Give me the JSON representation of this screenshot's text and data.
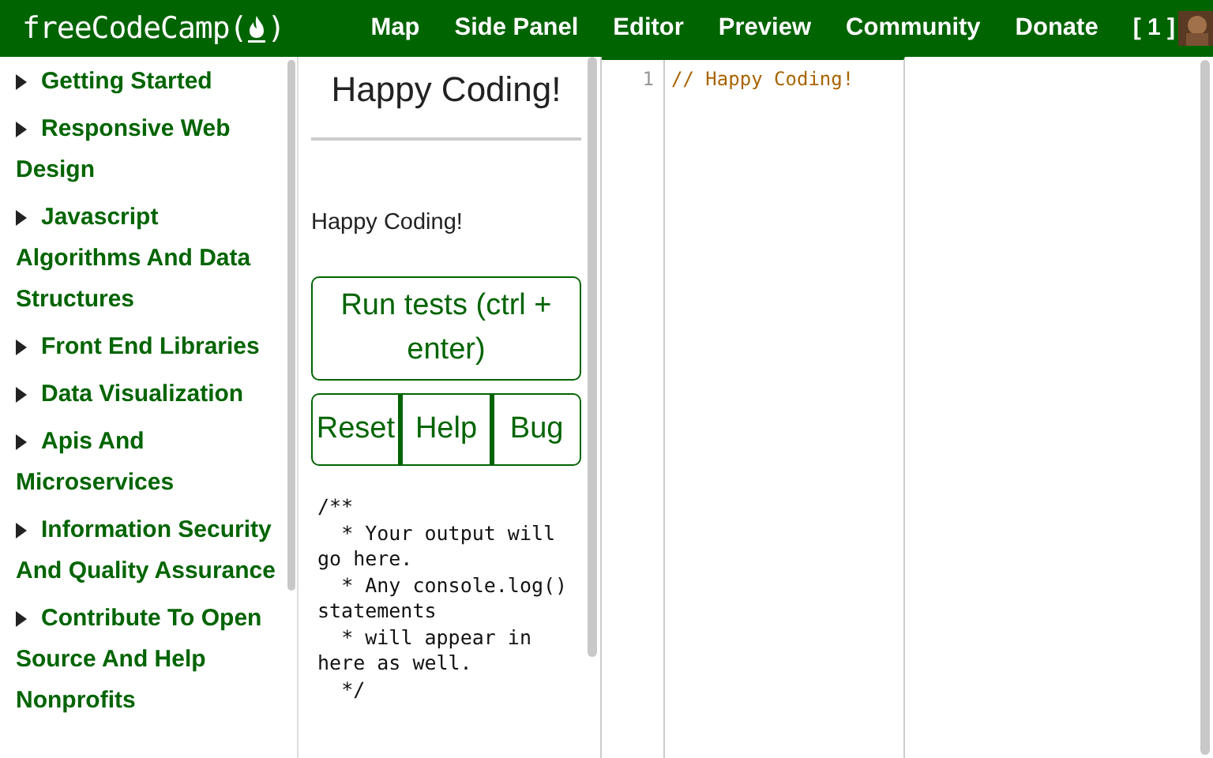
{
  "navbar": {
    "logo_text": "freeCodeCamp(",
    "logo_close": ")",
    "links": [
      "Map",
      "Side Panel",
      "Editor",
      "Preview",
      "Community",
      "Donate"
    ],
    "points": "[ 1 ]"
  },
  "sidebar": {
    "items": [
      {
        "label": "Getting Started",
        "expanded": false
      },
      {
        "label": "Responsive Web Design",
        "expanded": false
      },
      {
        "label": "Javascript Algorithms And Data Structures",
        "expanded": false
      },
      {
        "label": "Front End Libraries",
        "expanded": false
      },
      {
        "label": "Data Visualization",
        "expanded": false
      },
      {
        "label": "Apis And Microservices",
        "expanded": false
      },
      {
        "label": "Information Security And Quality Assurance",
        "expanded": false
      },
      {
        "label": "Contribute To Open Source And Help Nonprofits",
        "expanded": false
      }
    ]
  },
  "side_panel": {
    "title": "Happy Coding!",
    "description": "Happy Coding!",
    "run_button": "Run tests (ctrl + enter)",
    "buttons": [
      "Reset",
      "Help",
      "Bug"
    ],
    "output": "/**\n  * Your output will go here.\n  * Any console.log() statements\n  * will appear in here as well.\n  */"
  },
  "editor": {
    "lines": [
      {
        "number": "1",
        "code": "// Happy Coding!"
      }
    ]
  }
}
